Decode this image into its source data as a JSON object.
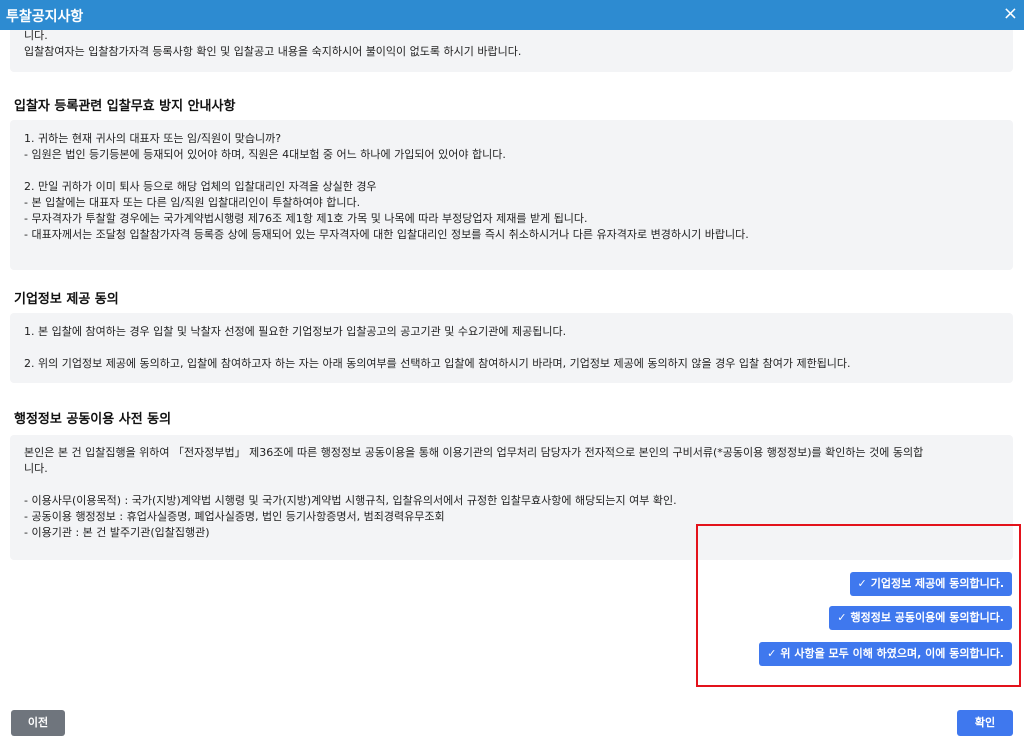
{
  "dialog": {
    "title": "투찰공지사항",
    "close_icon": "×"
  },
  "intro": {
    "lines": [
      "니다.",
      "입찰참여자는 입찰참가자격 등록사항 확인 및 입찰공고 내용을 숙지하시어 불이익이 없도록 하시기 바랍니다."
    ]
  },
  "section1": {
    "heading": "입찰자 등록관련 입찰무효 방지 안내사항",
    "lines": [
      "1. 귀하는 현재 귀사의 대표자 또는 임/직원이 맞습니까?",
      "- 임원은 법인 등기등본에 등재되어 있어야 하며, 직원은 4대보험 중 어느 하나에 가입되어 있어야 합니다.",
      "2. 만일 귀하가 이미 퇴사 등으로 해당 업체의 입찰대리인 자격을 상실한 경우",
      "- 본 입찰에는 대표자 또는 다른 임/직원 입찰대리인이 투찰하여야 합니다.",
      "- 무자격자가 투찰할 경우에는 국가계약법시행령 제76조 제1항 제1호 가목 및 나목에 따라 부정당업자 제재를 받게 됩니다.",
      "- 대표자께서는 조달청 입찰참가자격 등록증 상에 등재되어 있는 무자격자에 대한 입찰대리인 정보를 즉시 취소하시거나 다른 유자격자로 변경하시기 바랍니다."
    ]
  },
  "section2": {
    "heading": "기업정보 제공 동의",
    "lines": [
      "1. 본 입찰에 참여하는 경우 입찰 및 낙찰자 선정에 필요한 기업정보가 입찰공고의 공고기관 및 수요기관에 제공됩니다.",
      "2. 위의 기업정보 제공에 동의하고, 입찰에 참여하고자 하는 자는 아래 동의여부를 선택하고 입찰에 참여하시기 바라며, 기업정보 제공에 동의하지 않을 경우 입찰 참여가 제한됩니다."
    ]
  },
  "section3": {
    "heading": "행정정보 공동이용 사전 동의",
    "lines": [
      "본인은 본 건 입찰집행을 위하여 「전자정부법」 제36조에 따른 행정정보 공동이용을 통해 이용기관의 업무처리 담당자가 전자적으로 본인의 구비서류(*공동이용 행정정보)를 확인하는 것에 동의합",
      "니다.",
      "- 이용사무(이용목적) : 국가(지방)계약법 시행령 및 국가(지방)계약법 시행규칙, 입찰유의서에서 규정한 입찰무효사항에 해당되는지 여부 확인.",
      "- 공동이용 행정정보 : 휴업사실증명, 폐업사실증명, 법인 등기사항증명서, 범죄경력유무조회",
      "- 이용기관 : 본 건 발주기관(입찰집행관)"
    ]
  },
  "agreements": {
    "check_icon": "✓",
    "corp_info": "기업정보 제공에 동의합니다.",
    "admin_info": "행정정보 공동이용에 동의합니다.",
    "all": "위 사항을 모두 이해 하였으며, 이에 동의합니다."
  },
  "footer": {
    "prev_label": "이전",
    "ok_label": "확인"
  },
  "colors": {
    "titlebar": "#2d8bd1",
    "primary": "#3f78ee",
    "secondary": "#6f757d",
    "highlight": "#e3121b"
  }
}
